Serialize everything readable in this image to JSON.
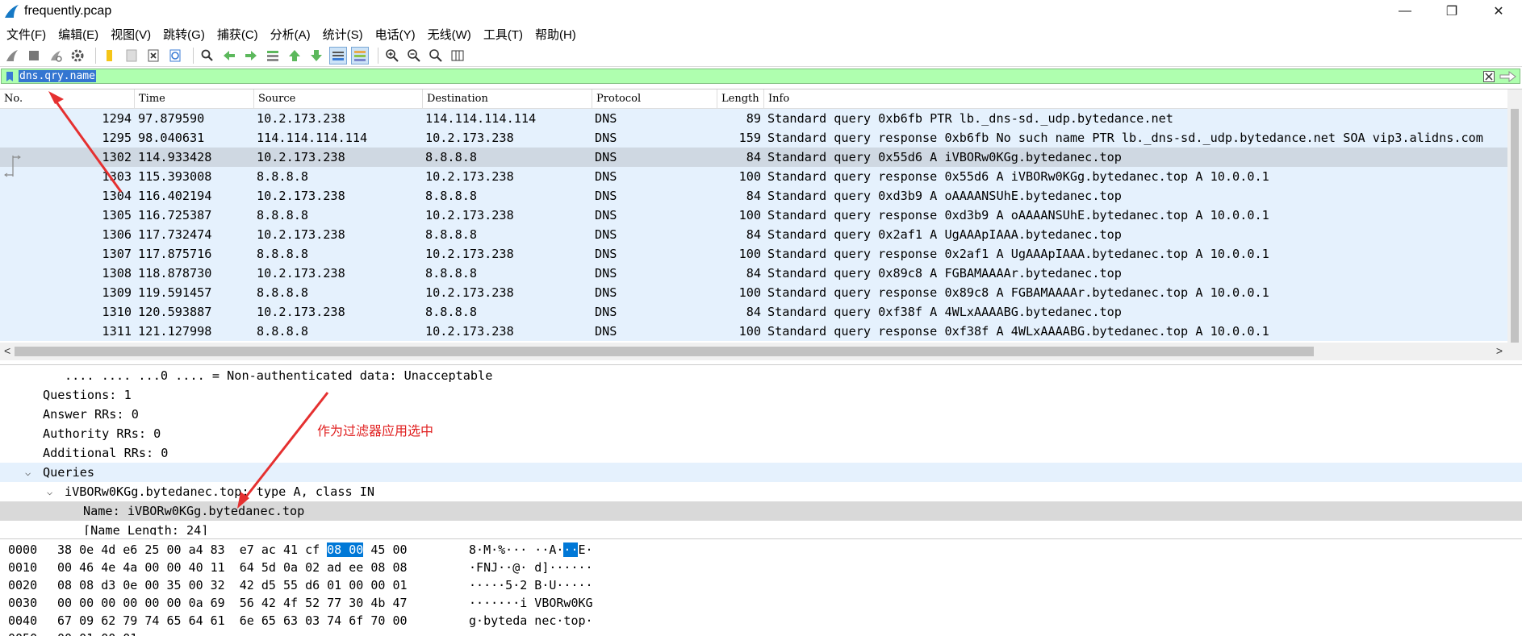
{
  "window": {
    "title": "frequently.pcap",
    "minimize_glyph": "—",
    "restore_glyph": "❐",
    "close_glyph": "✕"
  },
  "menu": [
    "文件(F)",
    "编辑(E)",
    "视图(V)",
    "跳转(G)",
    "捕获(C)",
    "分析(A)",
    "统计(S)",
    "电话(Y)",
    "无线(W)",
    "工具(T)",
    "帮助(H)"
  ],
  "toolbar_icons": [
    "shark-fin-start-icon",
    "stop-square-icon",
    "restart-icon",
    "options-gear-icon",
    "open-folder-icon",
    "save-file-icon",
    "close-file-icon",
    "reload-icon",
    "find-magnifier-icon",
    "go-back-arrow-icon",
    "go-forward-arrow-icon",
    "go-to-packet-icon",
    "first-packet-icon",
    "last-packet-icon",
    "autoscroll-icon",
    "colorize-icon",
    "zoom-in-icon",
    "zoom-out-icon",
    "normal-size-icon",
    "resize-columns-icon"
  ],
  "filter": {
    "value": "dns.qry.name",
    "accent": "#afffaf"
  },
  "columns": [
    "No.",
    "Time",
    "Source",
    "Destination",
    "Protocol",
    "Length",
    "Info"
  ],
  "packets": [
    {
      "no": "1294",
      "time": "97.879590",
      "src": "10.2.173.238",
      "dst": "114.114.114.114",
      "proto": "DNS",
      "len": "89",
      "info": "Standard query 0xb6fb PTR lb._dns-sd._udp.bytedance.net"
    },
    {
      "no": "1295",
      "time": "98.040631",
      "src": "114.114.114.114",
      "dst": "10.2.173.238",
      "proto": "DNS",
      "len": "159",
      "info": "Standard query response 0xb6fb No such name PTR lb._dns-sd._udp.bytedance.net SOA vip3.alidns.com"
    },
    {
      "no": "1302",
      "time": "114.933428",
      "src": "10.2.173.238",
      "dst": "8.8.8.8",
      "proto": "DNS",
      "len": "84",
      "info": "Standard query 0x55d6 A iVBORw0KGg.bytedanec.top"
    },
    {
      "no": "1303",
      "time": "115.393008",
      "src": "8.8.8.8",
      "dst": "10.2.173.238",
      "proto": "DNS",
      "len": "100",
      "info": "Standard query response 0x55d6 A iVBORw0KGg.bytedanec.top A 10.0.0.1"
    },
    {
      "no": "1304",
      "time": "116.402194",
      "src": "10.2.173.238",
      "dst": "8.8.8.8",
      "proto": "DNS",
      "len": "84",
      "info": "Standard query 0xd3b9 A oAAAANSUhE.bytedanec.top"
    },
    {
      "no": "1305",
      "time": "116.725387",
      "src": "8.8.8.8",
      "dst": "10.2.173.238",
      "proto": "DNS",
      "len": "100",
      "info": "Standard query response 0xd3b9 A oAAAANSUhE.bytedanec.top A 10.0.0.1"
    },
    {
      "no": "1306",
      "time": "117.732474",
      "src": "10.2.173.238",
      "dst": "8.8.8.8",
      "proto": "DNS",
      "len": "84",
      "info": "Standard query 0x2af1 A UgAAApIAAA.bytedanec.top"
    },
    {
      "no": "1307",
      "time": "117.875716",
      "src": "8.8.8.8",
      "dst": "10.2.173.238",
      "proto": "DNS",
      "len": "100",
      "info": "Standard query response 0x2af1 A UgAAApIAAA.bytedanec.top A 10.0.0.1"
    },
    {
      "no": "1308",
      "time": "118.878730",
      "src": "10.2.173.238",
      "dst": "8.8.8.8",
      "proto": "DNS",
      "len": "84",
      "info": "Standard query 0x89c8 A FGBAMAAAAr.bytedanec.top"
    },
    {
      "no": "1309",
      "time": "119.591457",
      "src": "8.8.8.8",
      "dst": "10.2.173.238",
      "proto": "DNS",
      "len": "100",
      "info": "Standard query response 0x89c8 A FGBAMAAAAr.bytedanec.top A 10.0.0.1"
    },
    {
      "no": "1310",
      "time": "120.593887",
      "src": "10.2.173.238",
      "dst": "8.8.8.8",
      "proto": "DNS",
      "len": "84",
      "info": "Standard query 0xf38f A 4WLxAAAABG.bytedanec.top"
    },
    {
      "no": "1311",
      "time": "121.127998",
      "src": "8.8.8.8",
      "dst": "10.2.173.238",
      "proto": "DNS",
      "len": "100",
      "info": "Standard query response 0xf38f A 4WLxAAAABG.bytedanec.top A 10.0.0.1"
    }
  ],
  "selected_packet": "1302",
  "details": [
    {
      "text": ".... .... ...0 .... = Non-authenticated data: Unacceptable",
      "indent": 80,
      "twisty": "",
      "style": ""
    },
    {
      "text": "Questions: 1",
      "indent": 53,
      "twisty": "",
      "style": ""
    },
    {
      "text": "Answer RRs: 0",
      "indent": 53,
      "twisty": "",
      "style": ""
    },
    {
      "text": "Authority RRs: 0",
      "indent": 53,
      "twisty": "",
      "style": ""
    },
    {
      "text": "Additional RRs: 0",
      "indent": 53,
      "twisty": "",
      "style": ""
    },
    {
      "text": "Queries",
      "indent": 53,
      "twisty": "⌵",
      "style": "hl"
    },
    {
      "text": "iVBORw0KGg.bytedanec.top: type A, class IN",
      "indent": 80,
      "twisty": "⌵",
      "style": ""
    },
    {
      "text": "Name: iVBORw0KGg.bytedanec.top",
      "indent": 103,
      "twisty": "",
      "style": "sel"
    },
    {
      "text": "[Name Length: 24]",
      "indent": 103,
      "twisty": "",
      "style": ""
    }
  ],
  "annotation": "作为过滤器应用选中",
  "bytes": [
    {
      "offset": "0000",
      "hex": [
        "38",
        "0e",
        "4d",
        "e6",
        "25",
        "00",
        "a4",
        "83",
        "e7",
        "ac",
        "41",
        "cf",
        "08",
        "00",
        "45",
        "00"
      ],
      "ascii": [
        "8",
        "·",
        "M",
        "·",
        "%",
        "·",
        "·",
        "·",
        "·",
        "·",
        "A",
        "·",
        "·",
        "·",
        "E",
        "·"
      ],
      "sel": [
        12,
        13
      ]
    },
    {
      "offset": "0010",
      "hex": [
        "00",
        "46",
        "4e",
        "4a",
        "00",
        "00",
        "40",
        "11",
        "64",
        "5d",
        "0a",
        "02",
        "ad",
        "ee",
        "08",
        "08"
      ],
      "ascii": [
        "·",
        "F",
        "N",
        "J",
        "·",
        "·",
        "@",
        "·",
        "d",
        "]",
        "·",
        "·",
        "·",
        "·",
        "·",
        "·"
      ],
      "sel": []
    },
    {
      "offset": "0020",
      "hex": [
        "08",
        "08",
        "d3",
        "0e",
        "00",
        "35",
        "00",
        "32",
        "42",
        "d5",
        "55",
        "d6",
        "01",
        "00",
        "00",
        "01"
      ],
      "ascii": [
        "·",
        "·",
        "·",
        "·",
        "·",
        "5",
        "·",
        "2",
        "B",
        "·",
        "U",
        "·",
        "·",
        "·",
        "·",
        "·"
      ],
      "sel": []
    },
    {
      "offset": "0030",
      "hex": [
        "00",
        "00",
        "00",
        "00",
        "00",
        "00",
        "0a",
        "69",
        "56",
        "42",
        "4f",
        "52",
        "77",
        "30",
        "4b",
        "47"
      ],
      "ascii": [
        "·",
        "·",
        "·",
        "·",
        "·",
        "·",
        "·",
        "i",
        "V",
        "B",
        "O",
        "R",
        "w",
        "0",
        "K",
        "G"
      ],
      "sel": []
    },
    {
      "offset": "0040",
      "hex": [
        "67",
        "09",
        "62",
        "79",
        "74",
        "65",
        "64",
        "61",
        "6e",
        "65",
        "63",
        "03",
        "74",
        "6f",
        "70",
        "00"
      ],
      "ascii": [
        "g",
        "·",
        "b",
        "y",
        "t",
        "e",
        "d",
        "a",
        "n",
        "e",
        "c",
        "·",
        "t",
        "o",
        "p",
        "·"
      ],
      "sel": []
    },
    {
      "offset": "0050",
      "hex": [
        "00",
        "01",
        "00",
        "01"
      ],
      "ascii": [
        "·",
        "·",
        "·",
        "·"
      ],
      "sel": []
    }
  ]
}
